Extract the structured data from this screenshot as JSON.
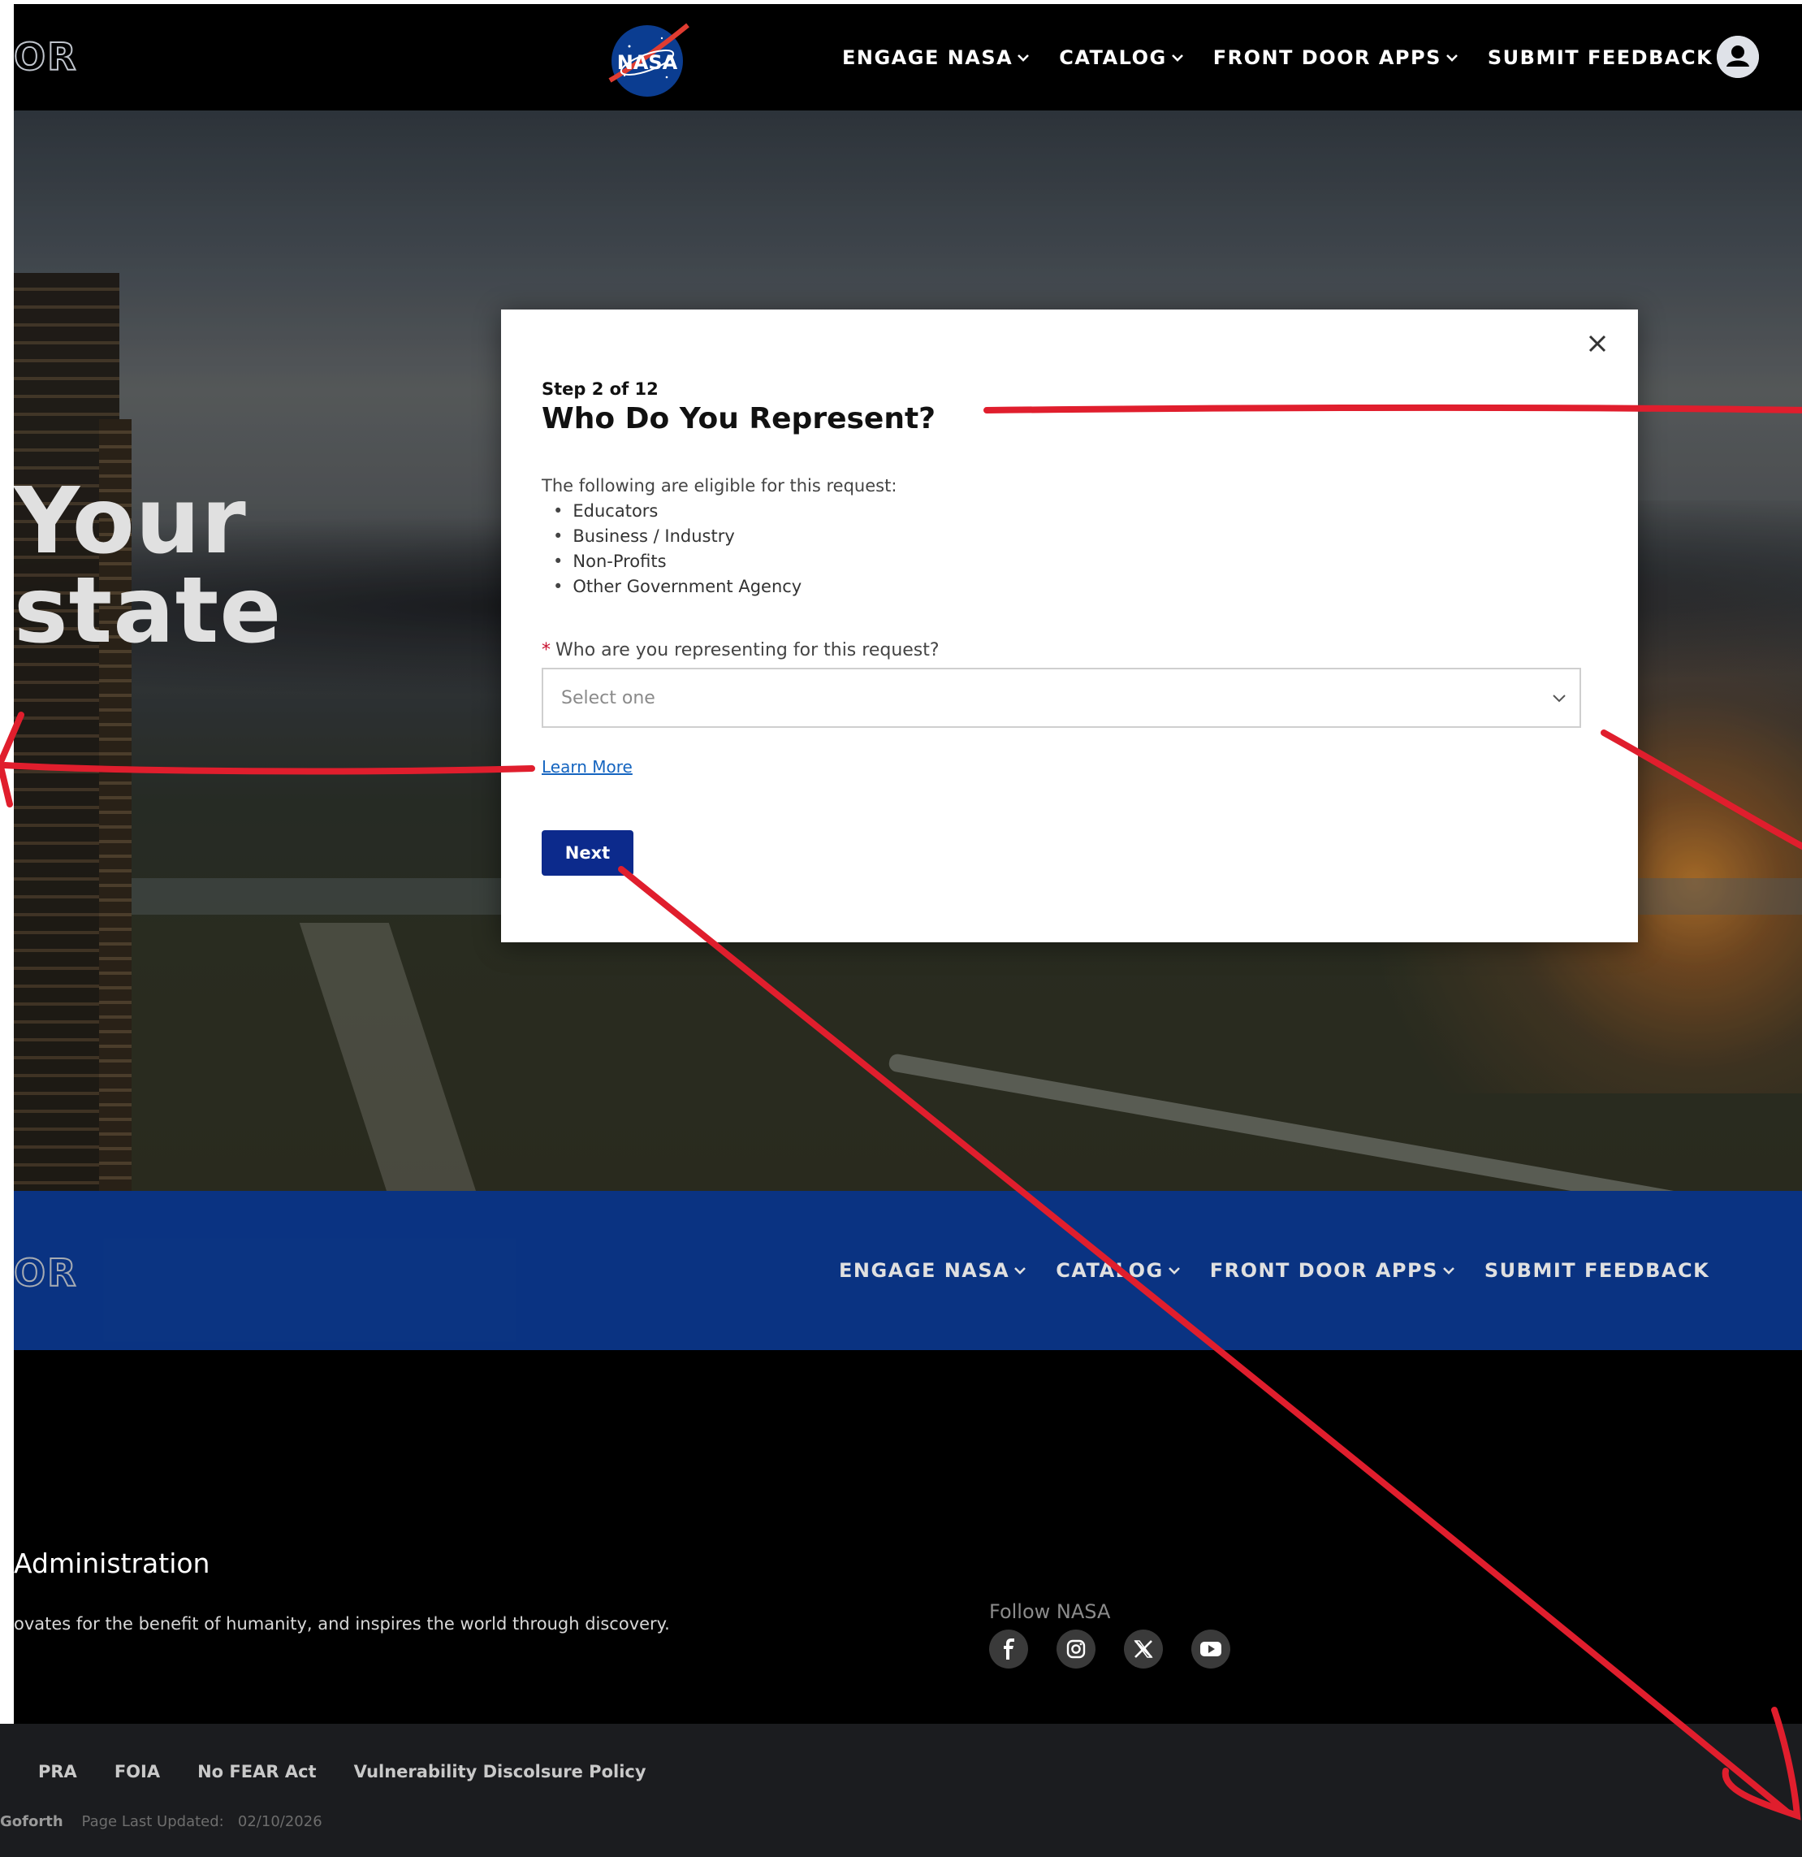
{
  "header": {
    "brand_fragment": "OR",
    "logo_text": "NASA",
    "nav": [
      {
        "label": "ENGAGE NASA",
        "dropdown": true
      },
      {
        "label": "CATALOG",
        "dropdown": true
      },
      {
        "label": "FRONT DOOR APPS",
        "dropdown": true
      },
      {
        "label": "SUBMIT FEEDBACK",
        "dropdown": false
      }
    ],
    "avatar_icon": "user-circle-icon"
  },
  "hero": {
    "line1": "Your",
    "line2": "state"
  },
  "modal": {
    "step": "Step 2 of 12",
    "title": "Who Do You Represent?",
    "eligible_intro": "The following are eligible for this request:",
    "eligible": [
      "Educators",
      "Business / Industry",
      "Non-Profits",
      "Other Government Agency"
    ],
    "question": "Who are you representing for this request?",
    "required_marker": "*",
    "select": {
      "placeholder": "Select one"
    },
    "learn_more": "Learn More",
    "next_label": "Next"
  },
  "bluebar": {
    "brand_fragment": "OR",
    "nav": [
      {
        "label": "ENGAGE NASA",
        "dropdown": true
      },
      {
        "label": "CATALOG",
        "dropdown": true
      },
      {
        "label": "FRONT DOOR APPS",
        "dropdown": true
      },
      {
        "label": "SUBMIT FEEDBACK",
        "dropdown": false
      }
    ]
  },
  "footer": {
    "title": "Administration",
    "mission": "ovates for the benefit of humanity, and inspires the world through discovery.",
    "follow_label": "Follow NASA",
    "social": [
      "facebook-icon",
      "instagram-icon",
      "x-icon",
      "youtube-icon"
    ],
    "links": [
      "PRA",
      "FOIA",
      "No FEAR Act",
      "Vulnerability Discolsure Policy"
    ],
    "owner": "Goforth",
    "updated_label": "Page Last Updated:",
    "updated_date": "02/10/2026"
  },
  "colors": {
    "nav_bg": "#000000",
    "bluebar_bg": "#0c3b94",
    "next_button": "#0c2a8c",
    "link": "#1565c0",
    "annotation_red": "#e01e2d",
    "required_red": "#c8102e"
  }
}
